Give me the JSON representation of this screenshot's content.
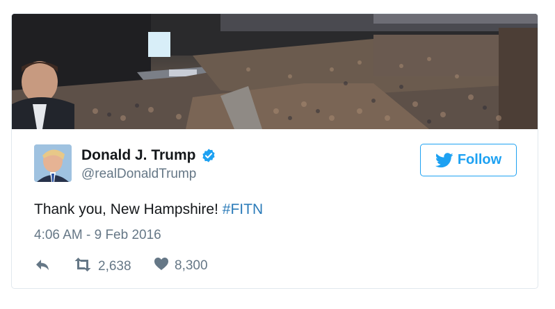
{
  "tweet": {
    "author": {
      "display_name": "Donald J. Trump",
      "handle": "@realDonaldTrump",
      "verified": true
    },
    "follow_label": "Follow",
    "text": "Thank you, New Hampshire!",
    "hashtag": "#FITN",
    "timestamp": "4:06 AM - 9 Feb 2016",
    "retweets": "2,638",
    "likes": "8,300"
  },
  "icons": {
    "verified": "verified-badge-icon",
    "follow": "twitter-bird-icon",
    "reply": "reply-icon",
    "retweet": "retweet-icon",
    "like": "heart-icon"
  },
  "colors": {
    "accent": "#1da1f2",
    "hashtag": "#2b7bb9",
    "secondary_text": "#657786",
    "border": "#e1e8ed"
  }
}
